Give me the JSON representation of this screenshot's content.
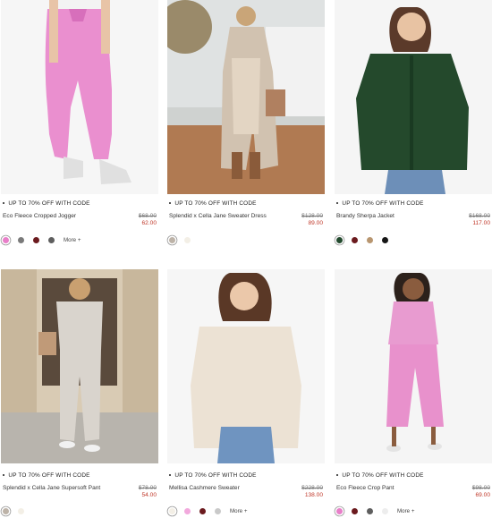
{
  "products": [
    {
      "promo": "UP TO 70% OFF WITH CODE",
      "name": "Eco Fleece Cropped Jogger",
      "price_original": "$68.00",
      "price_sale": "62.00",
      "swatches": [
        "#e87fc9",
        "#7a7a7a",
        "#6b1a1e",
        "#5e5e5e"
      ],
      "more": "More +"
    },
    {
      "promo": "UP TO 70% OFF WITH CODE",
      "name": "Splendid x Cella Jane Sweater Dress",
      "price_original": "$128.00",
      "price_sale": "89.00",
      "swatches": [
        "#bdb3a8",
        "#f3efe6"
      ],
      "more": ""
    },
    {
      "promo": "UP TO 70% OFF WITH CODE",
      "name": "Brandy Sherpa Jacket",
      "price_original": "$168.00",
      "price_sale": "117.00",
      "swatches": [
        "#234a2e",
        "#6b1a1e",
        "#b89670",
        "#151515"
      ],
      "more": ""
    },
    {
      "promo": "UP TO 70% OFF WITH CODE",
      "name": "Splendid x Cella Jane Supersoft Pant",
      "price_original": "$78.00",
      "price_sale": "54.00",
      "swatches": [
        "#bdb3a8",
        "#f3efe6"
      ],
      "more": ""
    },
    {
      "promo": "UP TO 70% OFF WITH CODE",
      "name": "Mellisa Cashmere Sweater",
      "price_original": "$228.00",
      "price_sale": "138.00",
      "swatches": [
        "#f3efe6",
        "#f2a9dd",
        "#6b1a1e",
        "#c9c9c9"
      ],
      "more": "More +"
    },
    {
      "promo": "UP TO 70% OFF WITH CODE",
      "name": "Eco Fleece Crop Pant",
      "price_original": "$98.00",
      "price_sale": "69.00",
      "swatches": [
        "#e87fc9",
        "#6b1a1e",
        "#5e5e5e",
        "#ededed"
      ],
      "more": "More +"
    }
  ]
}
